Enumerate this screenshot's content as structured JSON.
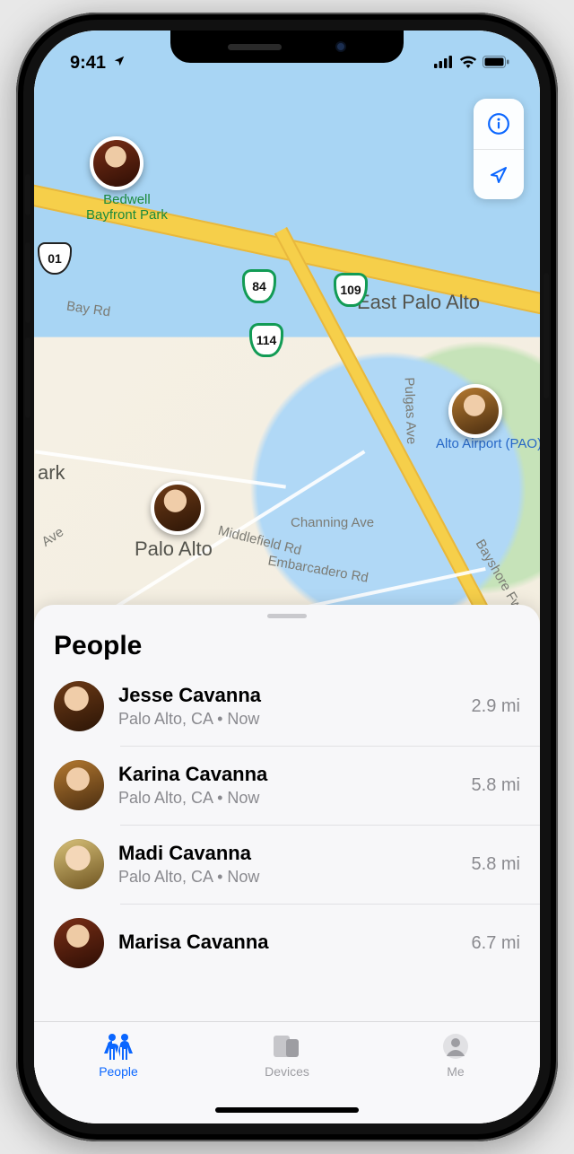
{
  "status": {
    "time": "9:41"
  },
  "map": {
    "labels": {
      "bedwell": "Bedwell\nBayfront Park",
      "east_palo_alto": "East Palo Alto",
      "palo_alto": "Palo Alto",
      "airport": "Alto Airport (PAO)",
      "ark": "ark",
      "bay_rd": "Bay Rd",
      "pulgas": "Pulgas Ave",
      "channing": "Channing Ave",
      "middlefield": "Middlefield Rd",
      "embarcadero": "Embarcadero Rd",
      "bayshore": "Bayshore Fwy",
      "ave": "Ave"
    },
    "shields": {
      "us101": "01",
      "ca84": "84",
      "ca109": "109",
      "ca114": "114"
    }
  },
  "sheet": {
    "title": "People",
    "people": [
      {
        "name": "Jesse Cavanna",
        "subtitle": "Palo Alto, CA • Now",
        "distance": "2.9 mi"
      },
      {
        "name": "Karina Cavanna",
        "subtitle": "Palo Alto, CA • Now",
        "distance": "5.8 mi"
      },
      {
        "name": "Madi Cavanna",
        "subtitle": "Palo Alto, CA • Now",
        "distance": "5.8 mi"
      },
      {
        "name": "Marisa Cavanna",
        "subtitle": "",
        "distance": "6.7 mi"
      }
    ]
  },
  "tabs": [
    {
      "id": "people",
      "label": "People",
      "active": true
    },
    {
      "id": "devices",
      "label": "Devices",
      "active": false
    },
    {
      "id": "me",
      "label": "Me",
      "active": false
    }
  ]
}
